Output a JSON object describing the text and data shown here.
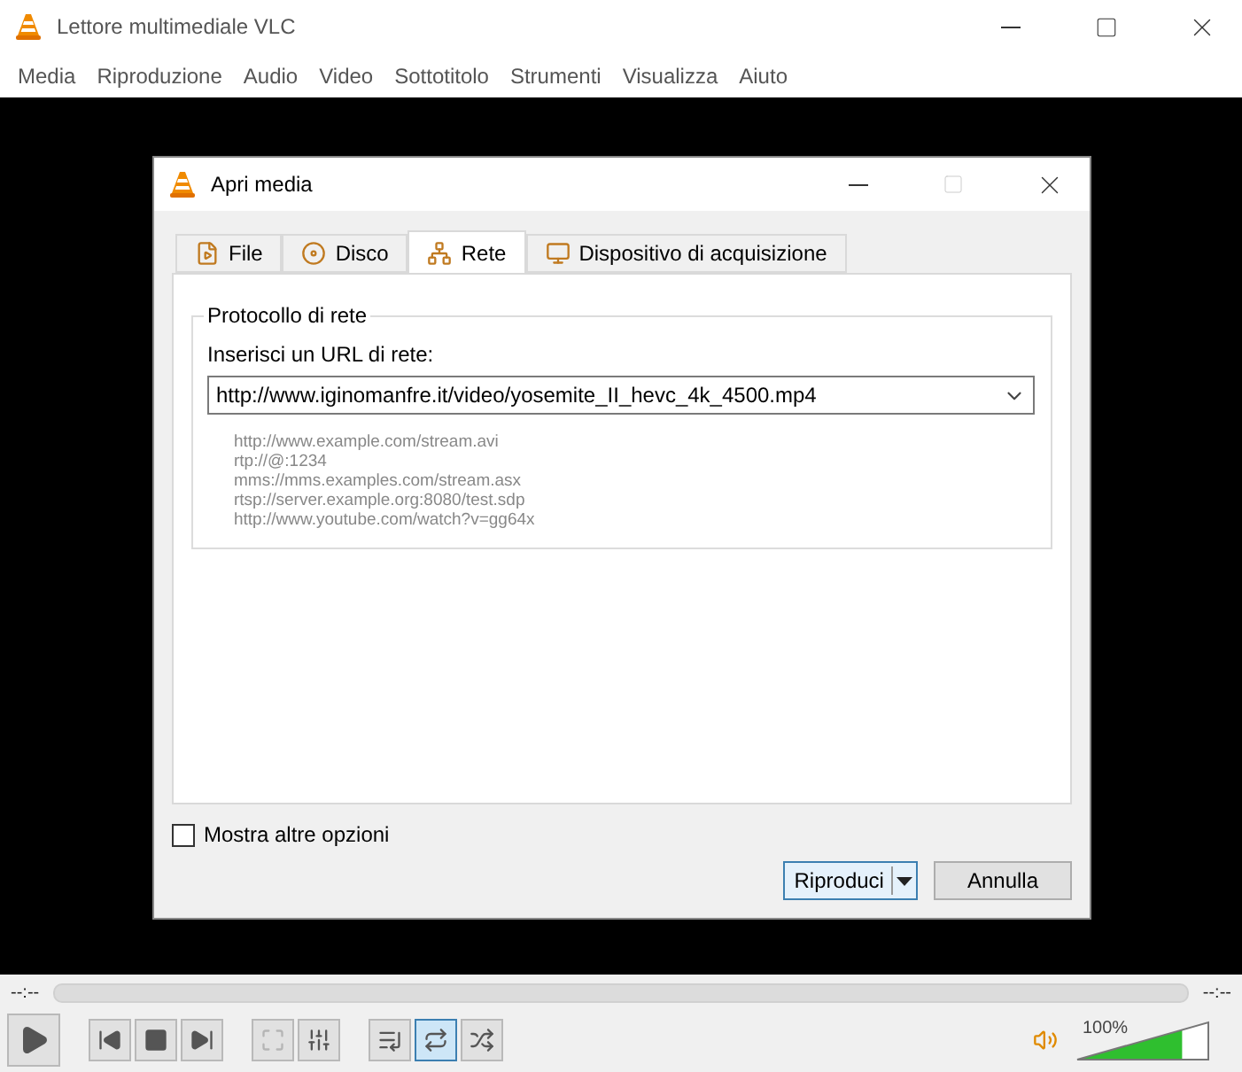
{
  "window": {
    "title": "Lettore multimediale VLC"
  },
  "menu": [
    "Media",
    "Riproduzione",
    "Audio",
    "Video",
    "Sottotitolo",
    "Strumenti",
    "Visualizza",
    "Aiuto"
  ],
  "dialog": {
    "title": "Apri media",
    "tabs": [
      {
        "label": "File",
        "kind": "file",
        "selected": false
      },
      {
        "label": "Disco",
        "kind": "disc",
        "selected": false
      },
      {
        "label": "Rete",
        "kind": "network",
        "selected": true
      },
      {
        "label": "Dispositivo di acquisizione",
        "kind": "capture",
        "selected": false
      }
    ],
    "group": {
      "title": "Protocollo di rete",
      "label": "Inserisci un URL di rete:",
      "value": "http://www.iginomanfre.it/video/yosemite_II_hevc_4k_4500.mp4",
      "examples": [
        "http://www.example.com/stream.avi",
        "rtp://@:1234",
        "mms://mms.examples.com/stream.asx",
        "rtsp://server.example.org:8080/test.sdp",
        "http://www.youtube.com/watch?v=gg64x"
      ]
    },
    "more_options": {
      "label": "Mostra altre opzioni",
      "checked": false
    },
    "buttons": [
      {
        "label": "Riproduci",
        "kind": "split",
        "default": true
      },
      {
        "label": "Annulla",
        "kind": "plain",
        "default": false
      }
    ]
  },
  "player": {
    "elapsed": "--:--",
    "remaining": "--:--",
    "controls": [
      {
        "kind": "play",
        "disabled": false,
        "selected": false
      },
      {
        "kind": "previous",
        "disabled": false,
        "selected": false
      },
      {
        "kind": "stop",
        "disabled": false,
        "selected": false
      },
      {
        "kind": "next",
        "disabled": false,
        "selected": false
      },
      {
        "kind": "fullscreen",
        "disabled": true,
        "selected": false
      },
      {
        "kind": "settings",
        "disabled": false,
        "selected": false
      },
      {
        "kind": "playlist",
        "disabled": false,
        "selected": false
      },
      {
        "kind": "loop",
        "disabled": false,
        "selected": true
      },
      {
        "kind": "random",
        "disabled": false,
        "selected": false
      }
    ],
    "volume": {
      "reading": "100%",
      "level": 0.8
    }
  }
}
